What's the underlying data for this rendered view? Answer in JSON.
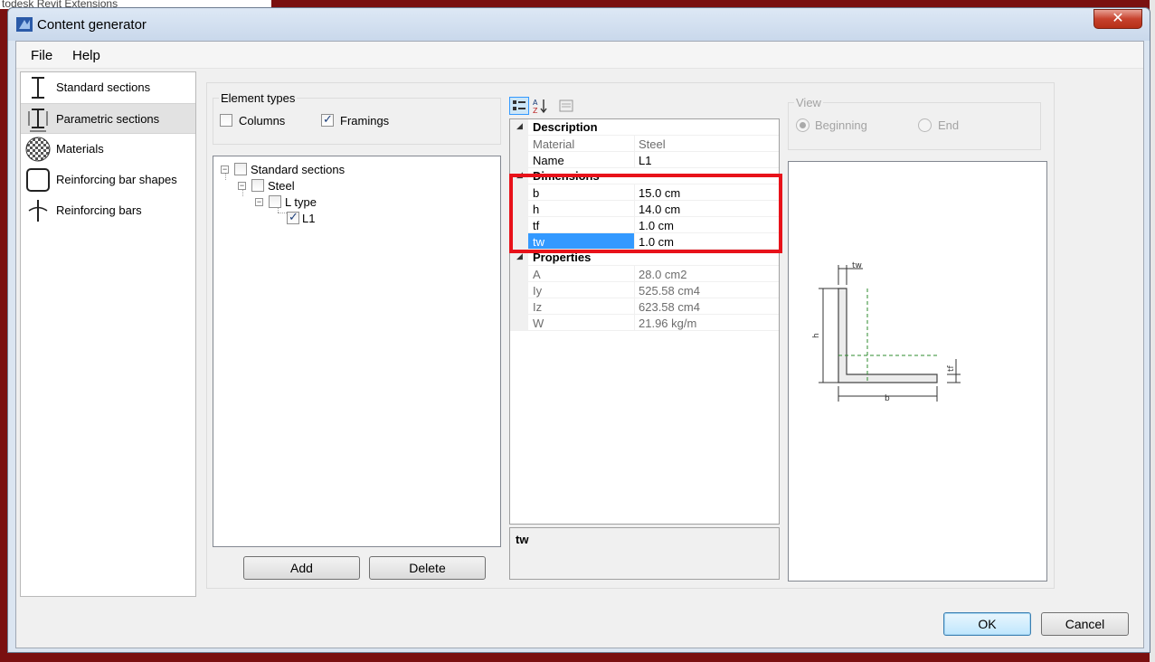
{
  "background": {
    "behind_title": "todesk Revit Extensions"
  },
  "window": {
    "title": "Content generator",
    "close_glyph": "✕"
  },
  "menu": {
    "items": [
      "File",
      "Help"
    ]
  },
  "sidebar": {
    "items": [
      {
        "label": "Standard sections",
        "icon": "i-beam-icon",
        "selected": false
      },
      {
        "label": "Parametric sections",
        "icon": "parametric-beam-icon",
        "selected": true
      },
      {
        "label": "Materials",
        "icon": "checker-material-icon",
        "selected": false
      },
      {
        "label": "Reinforcing bar shapes",
        "icon": "rounded-square-icon",
        "selected": false
      },
      {
        "label": "Reinforcing bars",
        "icon": "rebar-icon",
        "selected": false
      }
    ]
  },
  "element_types": {
    "title": "Element types",
    "columns": {
      "label": "Columns",
      "checked": false
    },
    "framings": {
      "label": "Framings",
      "checked": true
    }
  },
  "tree": {
    "nodes": [
      {
        "label": "Standard sections",
        "level": 0,
        "checked": false,
        "expander": "−"
      },
      {
        "label": "Steel",
        "level": 1,
        "checked": false,
        "expander": "−"
      },
      {
        "label": "L type",
        "level": 2,
        "checked": false,
        "expander": "−"
      },
      {
        "label": "L1",
        "level": 3,
        "checked": true,
        "expander": ""
      }
    ]
  },
  "buttons": {
    "add": "Add",
    "delete": "Delete",
    "ok": "OK",
    "cancel": "Cancel"
  },
  "toolbar": {
    "checkmark": "✓"
  },
  "property_grid": {
    "description": {
      "title": "Description",
      "rows": [
        {
          "name": "Material",
          "value": "Steel",
          "readonly": true
        },
        {
          "name": "Name",
          "value": "L1",
          "readonly": false
        }
      ]
    },
    "dimensions": {
      "title": "Dimensions",
      "rows": [
        {
          "name": "b",
          "value": "15.0 cm"
        },
        {
          "name": "h",
          "value": "14.0 cm"
        },
        {
          "name": "tf",
          "value": "1.0 cm"
        },
        {
          "name": "tw",
          "value": "1.0 cm",
          "selected": true
        }
      ]
    },
    "properties": {
      "title": "Properties",
      "rows": [
        {
          "name": "A",
          "value": "28.0 cm2"
        },
        {
          "name": "Iy",
          "value": "525.58 cm4"
        },
        {
          "name": "Iz",
          "value": "623.58 cm4"
        },
        {
          "name": "W",
          "value": "21.96 kg/m"
        }
      ]
    },
    "collapse_glyph": "◢"
  },
  "description_pane": {
    "title": "tw"
  },
  "view": {
    "title": "View",
    "beginning": {
      "label": "Beginning",
      "selected": true
    },
    "end": {
      "label": "End",
      "selected": false
    }
  },
  "drawing": {
    "labels": {
      "tw": "tw",
      "h": "h",
      "tf": "tf",
      "b": "b"
    }
  },
  "colors": {
    "highlight": "#e8121a",
    "selection": "#3399ff",
    "axis": "#2e8b2e"
  }
}
